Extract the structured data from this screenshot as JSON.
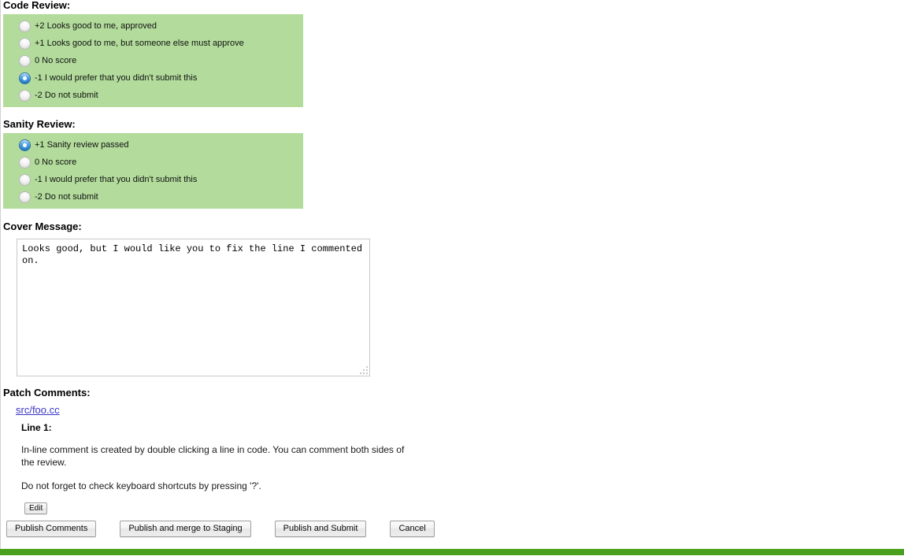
{
  "code_review": {
    "title": "Code Review:",
    "options": [
      {
        "label": "+2 Looks good to me, approved",
        "selected": false
      },
      {
        "label": "+1 Looks good to me, but someone else must approve",
        "selected": false
      },
      {
        "label": "0 No score",
        "selected": false
      },
      {
        "label": "-1 I would prefer that you didn't submit this",
        "selected": true
      },
      {
        "label": "-2 Do not submit",
        "selected": false
      }
    ]
  },
  "sanity_review": {
    "title": "Sanity Review:",
    "options": [
      {
        "label": "+1 Sanity review passed",
        "selected": true
      },
      {
        "label": "0 No score",
        "selected": false
      },
      {
        "label": "-1 I would prefer that you didn't submit this",
        "selected": false
      },
      {
        "label": "-2 Do not submit",
        "selected": false
      }
    ]
  },
  "cover_message": {
    "title": "Cover Message:",
    "value": "Looks good, but I would like you to fix the line I commented on.",
    "placeholder": ""
  },
  "patch_comments": {
    "title": "Patch Comments:",
    "file": "src/foo.cc",
    "line_title": "Line 1:",
    "paragraphs": [
      "In-line comment is created by double clicking a line in code. You can comment both sides of the review.",
      "Do not forget to check keyboard shortcuts by pressing '?'."
    ],
    "edit_label": "Edit"
  },
  "actions": {
    "publish_comments": "Publish Comments",
    "publish_merge_staging": "Publish and merge to Staging",
    "publish_submit": "Publish and Submit",
    "cancel": "Cancel"
  },
  "colors": {
    "score_box_background": "#b3dc9c",
    "footer_bar": "#49a01c",
    "link": "#3b35c8",
    "radio_selected": "#1a6fbd"
  }
}
